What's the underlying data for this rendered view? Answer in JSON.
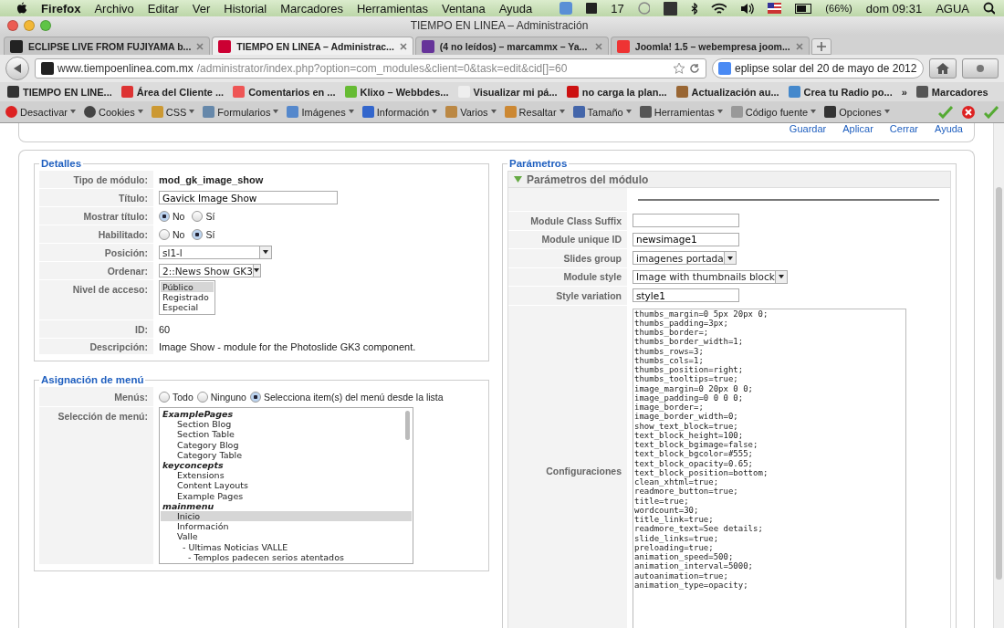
{
  "menubar": {
    "app": "Firefox",
    "items": [
      "Archivo",
      "Editar",
      "Ver",
      "Historial",
      "Marcadores",
      "Herramientas",
      "Ventana",
      "Ayuda"
    ],
    "count": "17",
    "battery": "(66%)",
    "clock": "dom 09:31",
    "user": "AGUA"
  },
  "window": {
    "title": "TIEMPO EN LINEA – Administración"
  },
  "tabs": [
    {
      "label": "ECLIPSE LIVE FROM FUJIYAMA b...",
      "selected": false
    },
    {
      "label": "TIEMPO EN LINEA – Administrac...",
      "selected": true
    },
    {
      "label": "(4 no leídos) – marcammx – Ya...",
      "selected": false
    },
    {
      "label": "Joomla! 1.5 – webempresa joom...",
      "selected": false
    }
  ],
  "address": {
    "host": "www.tiempoenlinea.com.mx",
    "path": "/administrator/index.php?option=com_modules&client=0&task=edit&cid[]=60"
  },
  "search": {
    "value": "eplipse solar del 20 de mayo de 2012"
  },
  "bookmarks": [
    "TIEMPO EN LINE...",
    "Área del Cliente ...",
    "Comentarios en ...",
    "Klixo – Webbdes...",
    "Visualizar mi pá...",
    "no carga la plan...",
    "Actualización au...",
    "Crea tu Radio po..."
  ],
  "bookmarks_overflow": "»",
  "bookmarks_menu": "Marcadores",
  "dev_toolbar": [
    "Desactivar",
    "Cookies",
    "CSS",
    "Formularios",
    "Imágenes",
    "Información",
    "Varios",
    "Resaltar",
    "Tamaño",
    "Herramientas",
    "Código fuente",
    "Opciones"
  ],
  "actions": [
    "Guardar",
    "Aplicar",
    "Cerrar",
    "Ayuda"
  ],
  "details": {
    "legend": "Detalles",
    "rows": [
      {
        "label": "Tipo de módulo:",
        "kind": "strong",
        "value": "mod_gk_image_show"
      },
      {
        "label": "Título:",
        "kind": "input",
        "value": "Gavick Image Show"
      },
      {
        "label": "Mostrar título:",
        "kind": "radio",
        "options": [
          {
            "label": "No",
            "selected": true
          },
          {
            "label": "Sí",
            "selected": false
          }
        ]
      },
      {
        "label": "Habilitado:",
        "kind": "radio",
        "options": [
          {
            "label": "No",
            "selected": false
          },
          {
            "label": "Sí",
            "selected": true
          }
        ]
      },
      {
        "label": "Posición:",
        "kind": "combo",
        "value": "sl1-l"
      },
      {
        "label": "Ordenar:",
        "kind": "select",
        "value": "2::News Show GK3"
      },
      {
        "label": "Nivel de acceso:",
        "kind": "listbox",
        "options": [
          {
            "label": "Público",
            "selected": true
          },
          {
            "label": "Registrado",
            "selected": false
          },
          {
            "label": "Especial",
            "selected": false
          }
        ]
      },
      {
        "label": "ID:",
        "kind": "text",
        "value": "60"
      },
      {
        "label": "Descripción:",
        "kind": "text",
        "value": "Image Show - module for the Photoslide GK3 component."
      }
    ]
  },
  "menu_assignment": {
    "legend": "Asignación de menú",
    "menus_label": "Menús:",
    "menus_options": [
      {
        "label": "Todo",
        "selected": false
      },
      {
        "label": "Ninguno",
        "selected": false
      },
      {
        "label": "Selecciona item(s) del menú desde la lista",
        "selected": true
      }
    ],
    "selection_label": "Selección de menú:",
    "items": [
      {
        "label": "ExamplePages",
        "kind": "group",
        "selected": false,
        "children": [
          {
            "label": "Section Blog",
            "selected": false
          },
          {
            "label": "Section Table",
            "selected": false
          },
          {
            "label": "Category Blog",
            "selected": false
          },
          {
            "label": "Category Table",
            "selected": false
          }
        ]
      },
      {
        "label": "keyconcepts",
        "kind": "group",
        "selected": false,
        "children": [
          {
            "label": "Extensions",
            "selected": false
          },
          {
            "label": "Content Layouts",
            "selected": false
          },
          {
            "label": "Example Pages",
            "selected": false
          }
        ]
      },
      {
        "label": "mainmenu",
        "kind": "group",
        "selected": false,
        "children": [
          {
            "label": "Inicio",
            "selected": true
          },
          {
            "label": "Información",
            "selected": false
          },
          {
            "label": "Valle",
            "selected": false,
            "children": [
              {
                "label": "- Ultimas Noticias VALLE",
                "selected": false,
                "children": [
                  {
                    "label": "- Templos padecen serios atentados",
                    "selected": false
                  }
                ]
              }
            ]
          }
        ]
      }
    ]
  },
  "parameters": {
    "legend": "Parámetros",
    "panel_title": "Parámetros del módulo",
    "expanded": true,
    "rows": [
      {
        "label": "Module Class Suffix",
        "kind": "input",
        "value": ""
      },
      {
        "label": "Module unique ID",
        "kind": "input",
        "value": "newsimage1"
      },
      {
        "label": "Slides group",
        "kind": "select",
        "value": "imagenes portada"
      },
      {
        "label": "Module style",
        "kind": "select",
        "value": "Image with thumbnails block"
      },
      {
        "label": "Style variation",
        "kind": "input",
        "value": "style1"
      }
    ],
    "config_label": "Configuraciones",
    "config": "thumbs_margin=0 5px 20px 0;\nthumbs_padding=3px;\nthumbs_border=;\nthumbs_border_width=1;\nthumbs_rows=3;\nthumbs_cols=1;\nthumbs_position=right;\nthumbs_tooltips=true;\nimage_margin=0 20px 0 0;\nimage_padding=0 0 0 0;\nimage_border=;\nimage_border_width=0;\nshow_text_block=true;\ntext_block_height=100;\ntext_block_bgimage=false;\ntext_block_bgcolor=#555;\ntext_block_opacity=0.65;\ntext_block_position=bottom;\nclean_xhtml=true;\nreadmore_button=true;\ntitle=true;\nwordcount=30;\ntitle_link=true;\nreadmore_text=See details;\nslide_links=true;\npreloading=true;\nanimation_speed=500;\nanimation_interval=5000;\nautoanimation=true;\nanimation_type=opacity;"
  }
}
